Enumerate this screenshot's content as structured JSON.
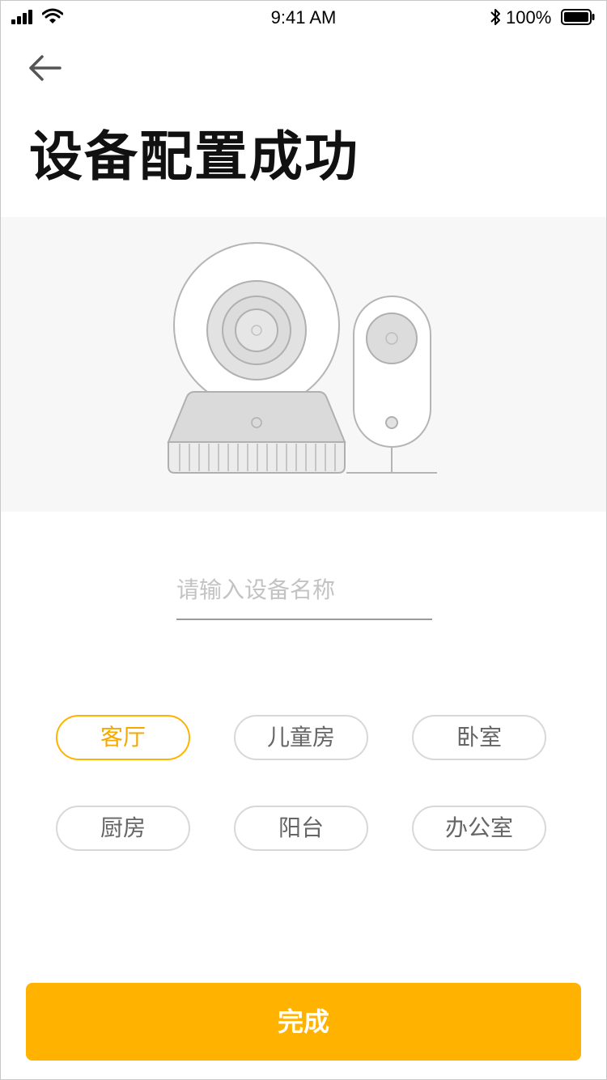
{
  "status_bar": {
    "time": "9:41 AM",
    "battery_text": "100%"
  },
  "header": {
    "title": "设备配置成功"
  },
  "form": {
    "name_placeholder": "请输入设备名称",
    "name_value": ""
  },
  "rooms": [
    {
      "label": "客厅",
      "selected": true
    },
    {
      "label": "儿童房",
      "selected": false
    },
    {
      "label": "卧室",
      "selected": false
    },
    {
      "label": "厨房",
      "selected": false
    },
    {
      "label": "阳台",
      "selected": false
    },
    {
      "label": "办公室",
      "selected": false
    }
  ],
  "actions": {
    "done_label": "完成"
  },
  "colors": {
    "accent": "#ffb300",
    "hero_bg": "#f7f7f7",
    "chip_border": "#d8d8d8"
  },
  "icons": [
    "signal-icon",
    "wifi-icon",
    "bluetooth-icon",
    "battery-icon",
    "back-arrow-icon"
  ]
}
